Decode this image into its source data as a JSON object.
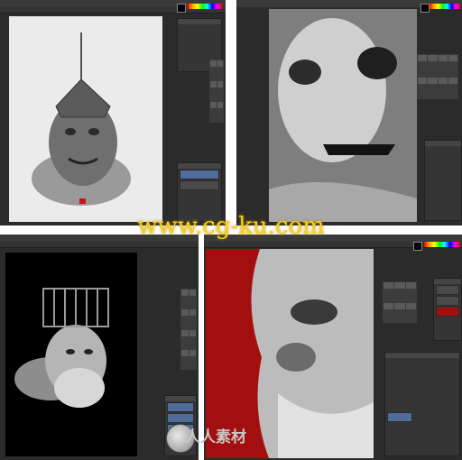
{
  "watermark": {
    "url_text": "www.cg-ku.com",
    "logo_text": "人人素材"
  },
  "quadrants": [
    {
      "id": "top-left",
      "menu": [
        "",
        "",
        "",
        "",
        "",
        ""
      ],
      "artwork": "demon-bust-with-crown",
      "canvas_bg": "#ebebeb"
    },
    {
      "id": "top-right",
      "menu": [
        "",
        "",
        "",
        "",
        "",
        ""
      ],
      "artwork": "skull-face-closeup",
      "canvas_bg": "#8a8a8a"
    },
    {
      "id": "bottom-left",
      "menu": [
        "",
        "",
        "",
        "",
        "",
        ""
      ],
      "artwork": "caged-head-bust",
      "canvas_bg": "#000000"
    },
    {
      "id": "bottom-right",
      "menu": [
        "",
        "",
        "",
        "",
        "",
        ""
      ],
      "artwork": "bearded-face-red-mask",
      "canvas_bg": "#a30f0f"
    }
  ],
  "colors": {
    "app_bg": "#2b2b2b",
    "panel_bg": "#353535",
    "selected_layer": "#4f6c9a",
    "mask_red": "#a30f0f",
    "watermark_yellow": "#f7d21d"
  }
}
